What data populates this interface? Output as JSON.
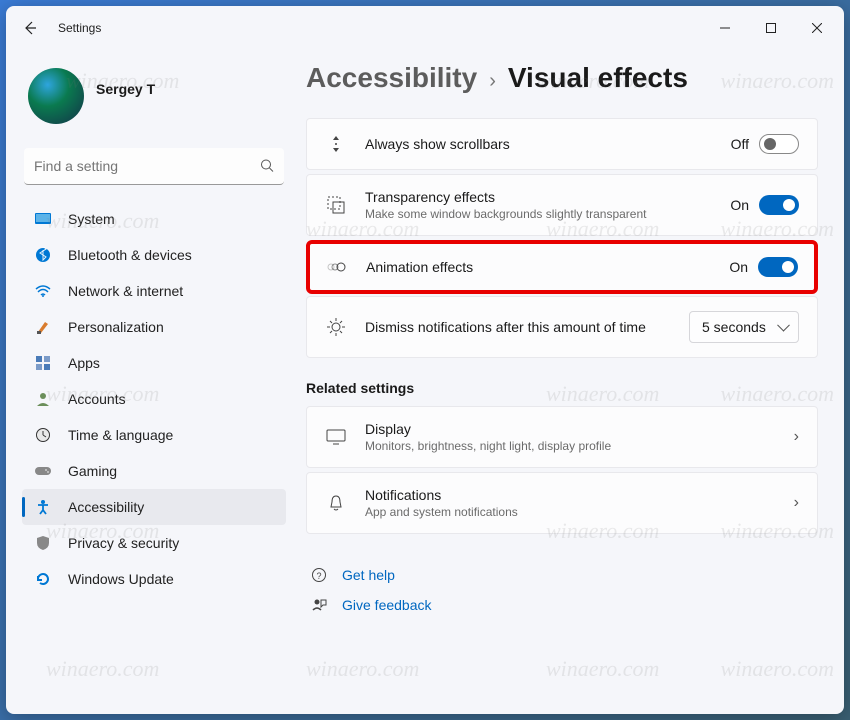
{
  "window": {
    "title": "Settings"
  },
  "profile": {
    "name": "Sergey T"
  },
  "search": {
    "placeholder": "Find a setting"
  },
  "sidebar": {
    "items": [
      {
        "label": "System"
      },
      {
        "label": "Bluetooth & devices"
      },
      {
        "label": "Network & internet"
      },
      {
        "label": "Personalization"
      },
      {
        "label": "Apps"
      },
      {
        "label": "Accounts"
      },
      {
        "label": "Time & language"
      },
      {
        "label": "Gaming"
      },
      {
        "label": "Accessibility"
      },
      {
        "label": "Privacy & security"
      },
      {
        "label": "Windows Update"
      }
    ]
  },
  "breadcrumb": {
    "parent": "Accessibility",
    "current": "Visual effects"
  },
  "settings": {
    "scrollbars": {
      "title": "Always show scrollbars",
      "state": "Off"
    },
    "transparency": {
      "title": "Transparency effects",
      "sub": "Make some window backgrounds slightly transparent",
      "state": "On"
    },
    "animation": {
      "title": "Animation effects",
      "state": "On"
    },
    "dismiss": {
      "title": "Dismiss notifications after this amount of time",
      "value": "5 seconds"
    }
  },
  "related": {
    "heading": "Related settings",
    "display": {
      "title": "Display",
      "sub": "Monitors, brightness, night light, display profile"
    },
    "notifications": {
      "title": "Notifications",
      "sub": "App and system notifications"
    }
  },
  "footer": {
    "help": "Get help",
    "feedback": "Give feedback"
  },
  "watermark": "winaero.com"
}
